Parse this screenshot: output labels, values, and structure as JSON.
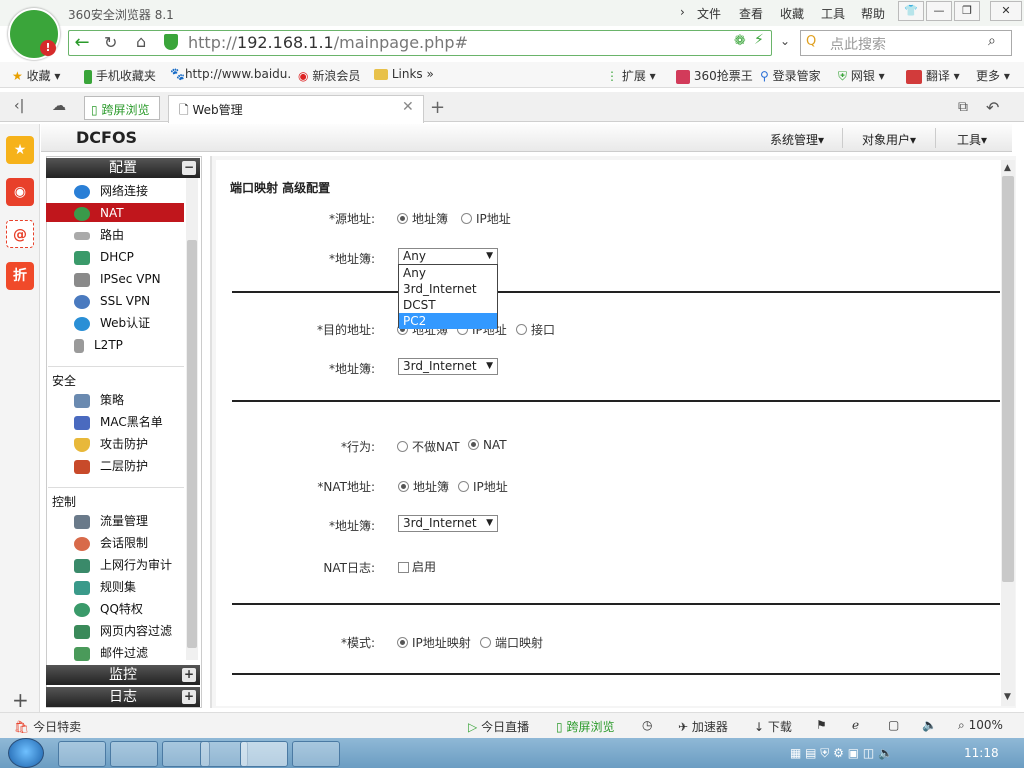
{
  "browser": {
    "app_title": "360安全浏览器 8.1",
    "menu": [
      "文件",
      "查看",
      "收藏",
      "工具",
      "帮助"
    ],
    "address": {
      "url_prefix": "http://",
      "url_host": "192.168.1.1",
      "url_path": "/mainpage.php#"
    },
    "search_placeholder": "点此搜索",
    "favorites": [
      "收藏",
      "手机收藏夹",
      "http://www.baidu.",
      "新浪会员",
      "Links",
      "扩展",
      "360抢票王",
      "登录管家",
      "网银",
      "翻译",
      "更多"
    ],
    "tabs": {
      "split_view": "跨屏浏览",
      "active": "Web管理"
    },
    "status": {
      "left": "今日特卖",
      "live": "今日直播",
      "split": "跨屏浏览",
      "accelerator": "加速器",
      "download": "下载",
      "zoom": "100%"
    }
  },
  "app": {
    "logo": "DCFOS",
    "top_menu": [
      "系统管理",
      "对象用户",
      "工具"
    ],
    "nav": {
      "config_header": "配置",
      "config_items": [
        "网络连接",
        "NAT",
        "路由",
        "DHCP",
        "IPSec VPN",
        "SSL VPN",
        "Web认证",
        "L2TP"
      ],
      "security_group": "安全",
      "security_items": [
        "策略",
        "MAC黑名单",
        "攻击防护",
        "二层防护"
      ],
      "control_group": "控制",
      "control_items": [
        "流量管理",
        "会话限制",
        "上网行为审计",
        "规则集",
        "QQ特权",
        "网页内容过滤",
        "邮件过滤"
      ],
      "monitor_header": "监控",
      "log_header": "日志"
    },
    "form": {
      "title": "端口映射 高级配置",
      "src_addr_label": "*源地址:",
      "src_addr_opt1": "地址簿",
      "src_addr_opt2": "IP地址",
      "addrbook_label": "*地址簿:",
      "src_addrbook_value": "Any",
      "dropdown_options": [
        "Any",
        "3rd_Internet",
        "DCST",
        "PC2"
      ],
      "dst_addr_label": "*目的地址:",
      "dst_addr_opt1": "地址簿",
      "dst_addr_opt2": "IP地址",
      "dst_addr_opt3": "接口",
      "dst_addrbook_value": "3rd_Internet",
      "action_label": "*行为:",
      "action_opt1": "不做NAT",
      "action_opt2": "NAT",
      "nat_addr_label": "*NAT地址:",
      "nat_addr_opt1": "地址簿",
      "nat_addr_opt2": "IP地址",
      "nat_addrbook_value": "3rd_Internet",
      "nat_log_label": "NAT日志:",
      "nat_log_opt": "启用",
      "mode_label": "*模式:",
      "mode_opt1": "IP地址映射",
      "mode_opt2": "端口映射"
    }
  },
  "taskbar": {
    "clock": "11:18"
  },
  "colors": {
    "nav_active": "#c0161c",
    "dropdown_selected": "#3399ff",
    "brand_green": "#3aa53a"
  }
}
